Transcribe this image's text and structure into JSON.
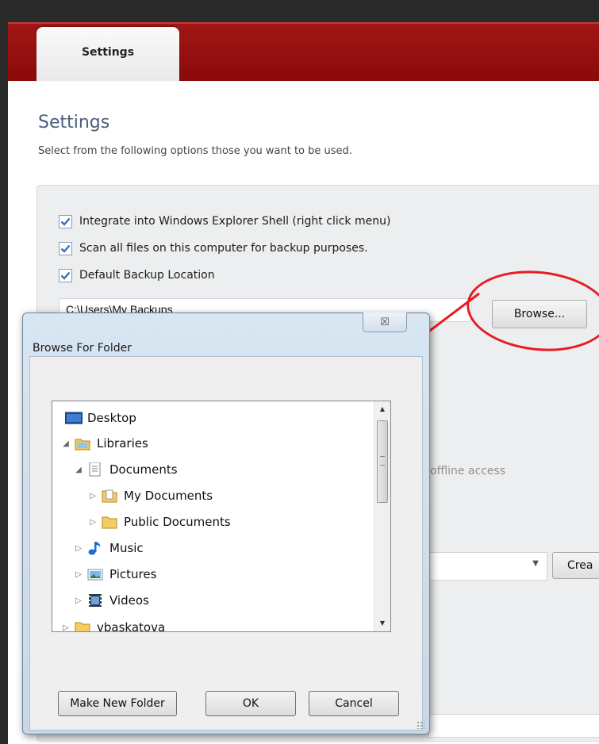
{
  "tabs": [
    {
      "label": "Settings"
    }
  ],
  "page": {
    "heading": "Settings",
    "subheading": "Select from the following options those you want to be used."
  },
  "options": [
    {
      "label": "Integrate into Windows Explorer Shell (right click menu)",
      "checked": true
    },
    {
      "label": "Scan all files on this computer for backup purposes.",
      "checked": true
    },
    {
      "label": "Default Backup Location",
      "checked": true
    }
  ],
  "backup_location": {
    "value": "C:\\Users\\My Backups"
  },
  "browse_button": {
    "label": "Browse..."
  },
  "background": {
    "offline_text": "offline access",
    "create_button": "Crea"
  },
  "dialog": {
    "title": "Browse For Folder",
    "close_glyph": "☒",
    "tree": [
      {
        "label": "Desktop",
        "icon": "desktop-icon",
        "expander": ""
      },
      {
        "label": "Libraries",
        "icon": "libraries-icon",
        "expander": "◢"
      },
      {
        "label": "Documents",
        "icon": "document-icon",
        "expander": "◢"
      },
      {
        "label": "My Documents",
        "icon": "folder-icon",
        "expander": "▷"
      },
      {
        "label": "Public Documents",
        "icon": "folder-icon",
        "expander": "▷"
      },
      {
        "label": "Music",
        "icon": "music-icon",
        "expander": "▷"
      },
      {
        "label": "Pictures",
        "icon": "pictures-icon",
        "expander": "▷"
      },
      {
        "label": "Videos",
        "icon": "videos-icon",
        "expander": "▷"
      },
      {
        "label": "vbaskatova",
        "icon": "user-folder-icon",
        "expander": "▷"
      }
    ],
    "buttons": {
      "make_new_folder": "Make New Folder",
      "ok": "OK",
      "cancel": "Cancel"
    }
  },
  "colors": {
    "header_red": "#9b1010",
    "heading_blue": "#4a5e7c",
    "annotation_red": "#e81b23",
    "checkbox_blue": "#2f72c4"
  }
}
